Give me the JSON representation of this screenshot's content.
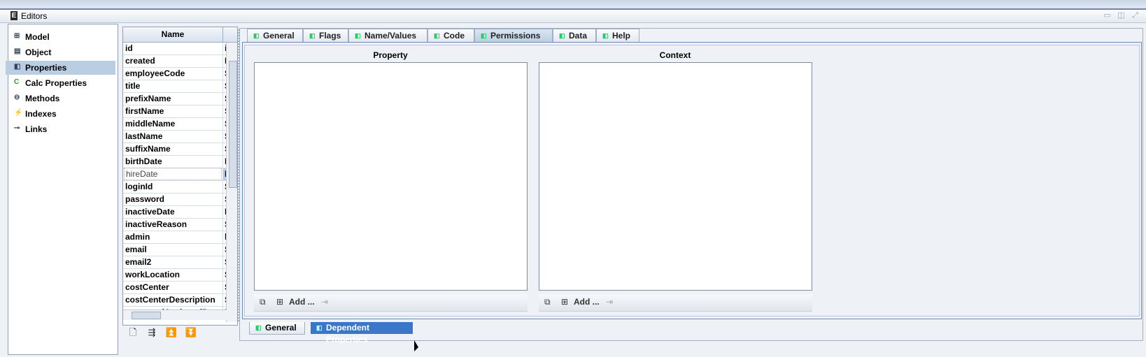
{
  "window": {
    "title": "Editors"
  },
  "nav": {
    "items": [
      {
        "label": "Model",
        "icon": "model-icon"
      },
      {
        "label": "Object",
        "icon": "object-icon"
      },
      {
        "label": "Properties",
        "icon": "properties-icon",
        "selected": true
      },
      {
        "label": "Calc Properties",
        "icon": "calc-properties-icon"
      },
      {
        "label": "Methods",
        "icon": "methods-icon"
      },
      {
        "label": "Indexes",
        "icon": "indexes-icon"
      },
      {
        "label": "Links",
        "icon": "links-icon"
      }
    ]
  },
  "table": {
    "header": "Name",
    "rows": [
      {
        "name": "id",
        "type": "ir"
      },
      {
        "name": "created",
        "type": "D"
      },
      {
        "name": "employeeCode",
        "type": "S"
      },
      {
        "name": "title",
        "type": "S"
      },
      {
        "name": "prefixName",
        "type": "S"
      },
      {
        "name": "firstName",
        "type": "S"
      },
      {
        "name": "middleName",
        "type": "S"
      },
      {
        "name": "lastName",
        "type": "S"
      },
      {
        "name": "suffixName",
        "type": "S"
      },
      {
        "name": "birthDate",
        "type": "D"
      },
      {
        "name": "hireDate",
        "type": "D",
        "selected": true
      },
      {
        "name": "loginId",
        "type": "S"
      },
      {
        "name": "password",
        "type": "S"
      },
      {
        "name": "inactiveDate",
        "type": "D"
      },
      {
        "name": "inactiveReason",
        "type": "S"
      },
      {
        "name": "admin",
        "type": "b"
      },
      {
        "name": "email",
        "type": "S"
      },
      {
        "name": "email2",
        "type": "S"
      },
      {
        "name": "workLocation",
        "type": "S"
      },
      {
        "name": "costCenter",
        "type": "S"
      },
      {
        "name": "costCenterDescription",
        "type": "S"
      },
      {
        "name": "passwordAssignedD...",
        "type": "D"
      }
    ]
  },
  "tabs": [
    "General",
    "Flags",
    "Name/Values",
    "Code",
    "Permissions",
    "Data",
    "Help"
  ],
  "active_tab": "Permissions",
  "panels": {
    "property_label": "Property",
    "context_label": "Context",
    "add_label": "Add ..."
  },
  "bottom_tabs": [
    "General",
    "Dependent Properties"
  ],
  "active_bottom_tab": "Dependent Properties"
}
